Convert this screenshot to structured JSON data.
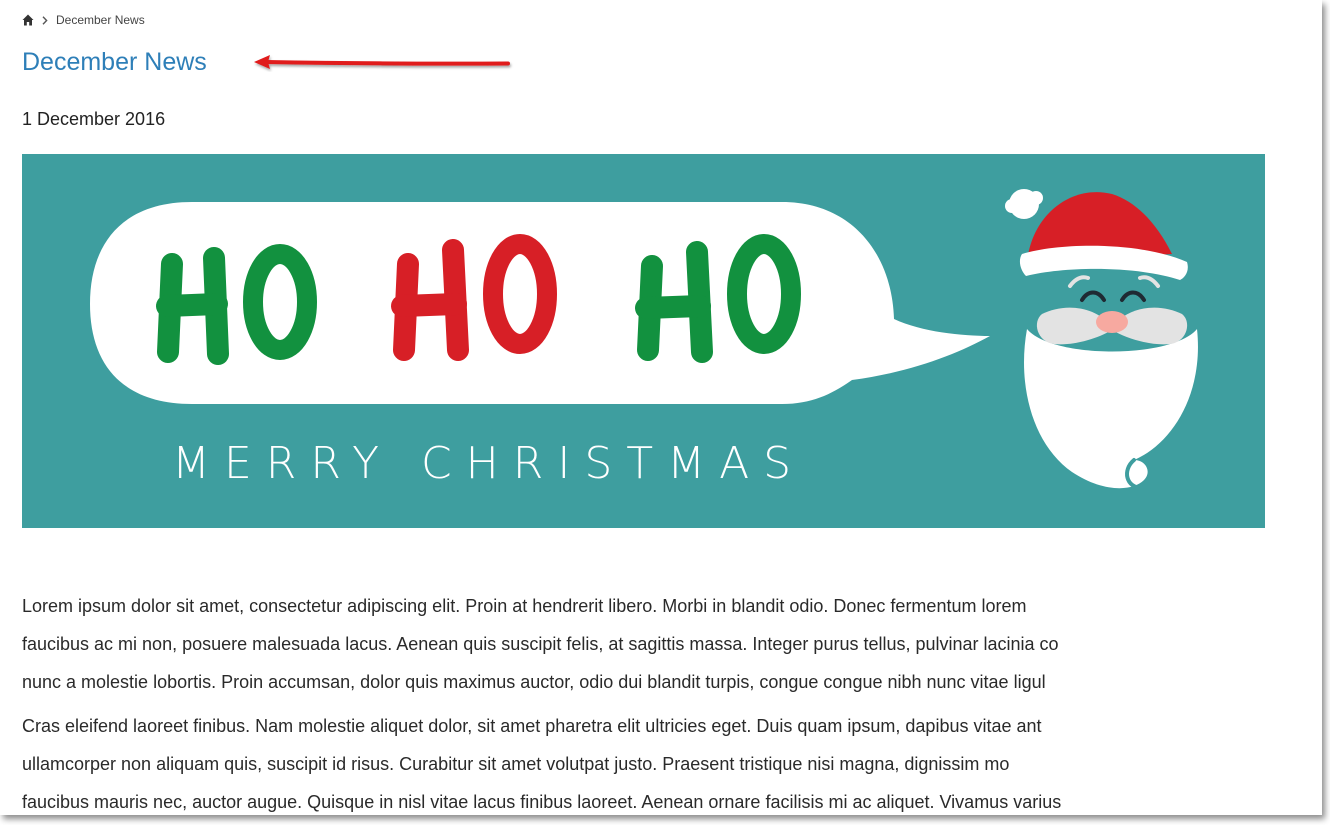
{
  "breadcrumb": {
    "home_icon": "home-icon",
    "separator_icon": "chevron-right-icon",
    "current": "December News"
  },
  "page": {
    "title": "December News",
    "date": "1 December 2016",
    "title_color": "#2e7fb8",
    "annotation_arrow_color": "#e01b1b"
  },
  "banner": {
    "background_color": "#3e9e9f",
    "ho_words": [
      "HO",
      "HO",
      "HO"
    ],
    "ho_colors": [
      "#12913f",
      "#d71f26",
      "#12913f"
    ],
    "subtitle": "MERRY CHRISTMAS",
    "illustration": "santa-face-icon"
  },
  "article": {
    "paragraphs": [
      [
        "Lorem ipsum dolor sit amet, consectetur adipiscing elit. Proin at hendrerit libero. Morbi in blandit odio. Donec fermentum lorem",
        "faucibus ac mi non, posuere malesuada lacus. Aenean quis suscipit felis, at sagittis massa. Integer purus tellus, pulvinar lacinia co",
        "nunc a molestie lobortis. Proin accumsan, dolor quis maximus auctor, odio dui blandit turpis, congue congue nibh nunc vitae ligul"
      ],
      [
        "Cras eleifend laoreet finibus. Nam molestie aliquet dolor, sit amet pharetra elit ultricies eget. Duis quam ipsum, dapibus vitae ant",
        "ullamcorper non aliquam quis, suscipit id risus. Curabitur sit amet volutpat justo. Praesent tristique nisi magna, dignissim mo",
        "faucibus mauris nec, auctor augue. Quisque in nisl vitae lacus finibus laoreet. Aenean ornare facilisis mi ac aliquet. Vivamus varius"
      ]
    ]
  }
}
